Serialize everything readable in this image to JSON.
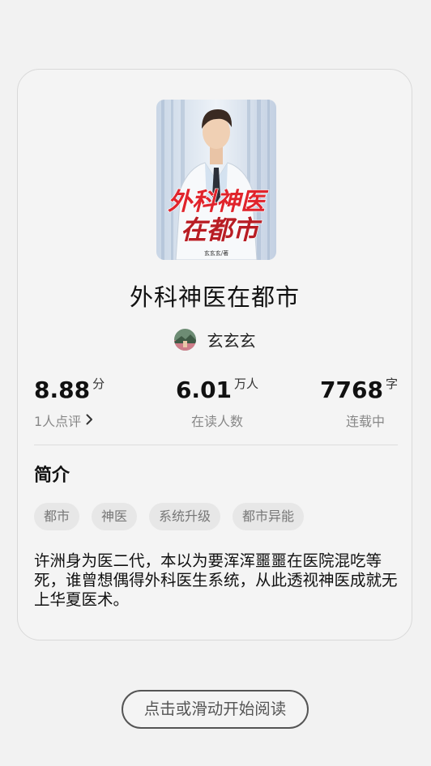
{
  "book": {
    "title": "外科神医在都市",
    "cover_title_line1": "外科神医",
    "cover_title_line2": "在都市",
    "cover_byline": "玄玄玄/著",
    "author": "玄玄玄"
  },
  "stats": {
    "rating_value": "8.88",
    "rating_unit": "分",
    "rating_label": "1人点评",
    "readers_value": "6.01",
    "readers_unit": "万人",
    "readers_label": "在读人数",
    "words_value": "7768",
    "words_unit": "字",
    "words_label": "连载中"
  },
  "intro": {
    "heading": "简介",
    "tags": [
      "都市",
      "神医",
      "系统升级",
      "都市异能"
    ],
    "text": "许洲身为医二代，本以为要浑浑噩噩在医院混吃等死，谁曾想偶得外科医生系统，从此透视神医成就无上华夏医术。"
  },
  "action": {
    "start_reading_label": "点击或滑动开始阅读"
  },
  "colors": {
    "cover_title_red": "#e0242c",
    "background": "#f2f2f2"
  },
  "icons": {
    "rating_more": "chevron-right-icon"
  }
}
